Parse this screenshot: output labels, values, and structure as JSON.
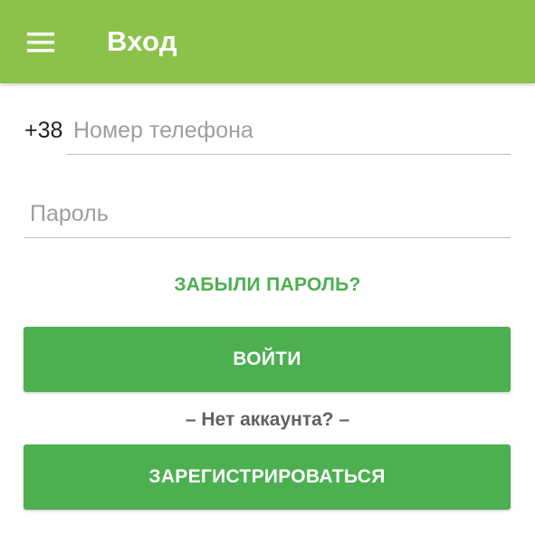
{
  "appbar": {
    "title": "Вход",
    "menu_icon": "hamburger-menu-icon",
    "background": "#8bc34a"
  },
  "form": {
    "phone_prefix": "+38",
    "phone_placeholder": "Номер телефона",
    "phone_value": "",
    "password_placeholder": "Пароль",
    "password_value": ""
  },
  "forgot_password_label": "ЗАБЫЛИ ПАРОЛЬ?",
  "login_button_label": "ВОЙТИ",
  "no_account_label": "– Нет аккаунта? –",
  "register_button_label": "ЗАРЕГИСТРИРОВАТЬСЯ",
  "colors": {
    "accent": "#4caf50",
    "appbar": "#8bc34a"
  }
}
